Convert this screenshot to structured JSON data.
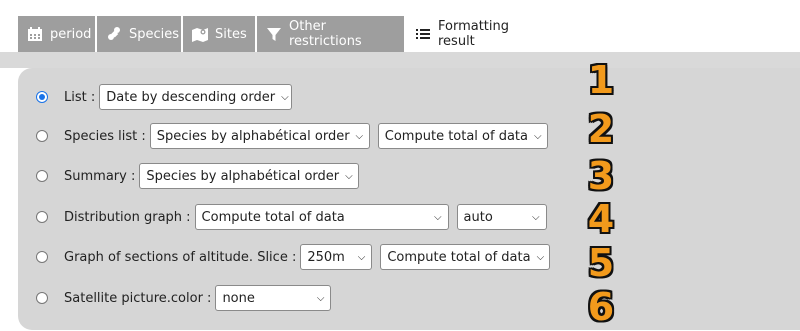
{
  "tabs": [
    {
      "label": "period",
      "icon": "calendar-icon"
    },
    {
      "label": "Species",
      "icon": "species-icon"
    },
    {
      "label": "Sites",
      "icon": "map-icon"
    },
    {
      "label": "Other restrictions",
      "icon": "filter-icon"
    },
    {
      "label": "Formatting result",
      "icon": "list-icon"
    }
  ],
  "options": [
    {
      "label": "List :",
      "selected": true,
      "selects": [
        "Date by descending order"
      ],
      "badge": "1"
    },
    {
      "label": "Species list :",
      "selected": false,
      "selects": [
        "Species by alphabétical order",
        "Compute total of data"
      ],
      "badge": "2"
    },
    {
      "label": "Summary :",
      "selected": false,
      "selects": [
        "Species by alphabétical order"
      ],
      "badge": "3"
    },
    {
      "label": "Distribution graph :",
      "selected": false,
      "selects": [
        "Compute total of data",
        "auto"
      ],
      "badge": "4"
    },
    {
      "label": "Graph of sections of altitude. Slice :",
      "selected": false,
      "selects": [
        "250m",
        "Compute total of data"
      ],
      "badge": "5"
    },
    {
      "label": "Satellite picture.color :",
      "selected": false,
      "selects": [
        "none"
      ],
      "badge": "6"
    }
  ],
  "colors": {
    "accent": "#1a73e8",
    "badge": "#f29a1c",
    "tab_inactive": "#9e9e9e",
    "panel": "#d6d6d6"
  }
}
